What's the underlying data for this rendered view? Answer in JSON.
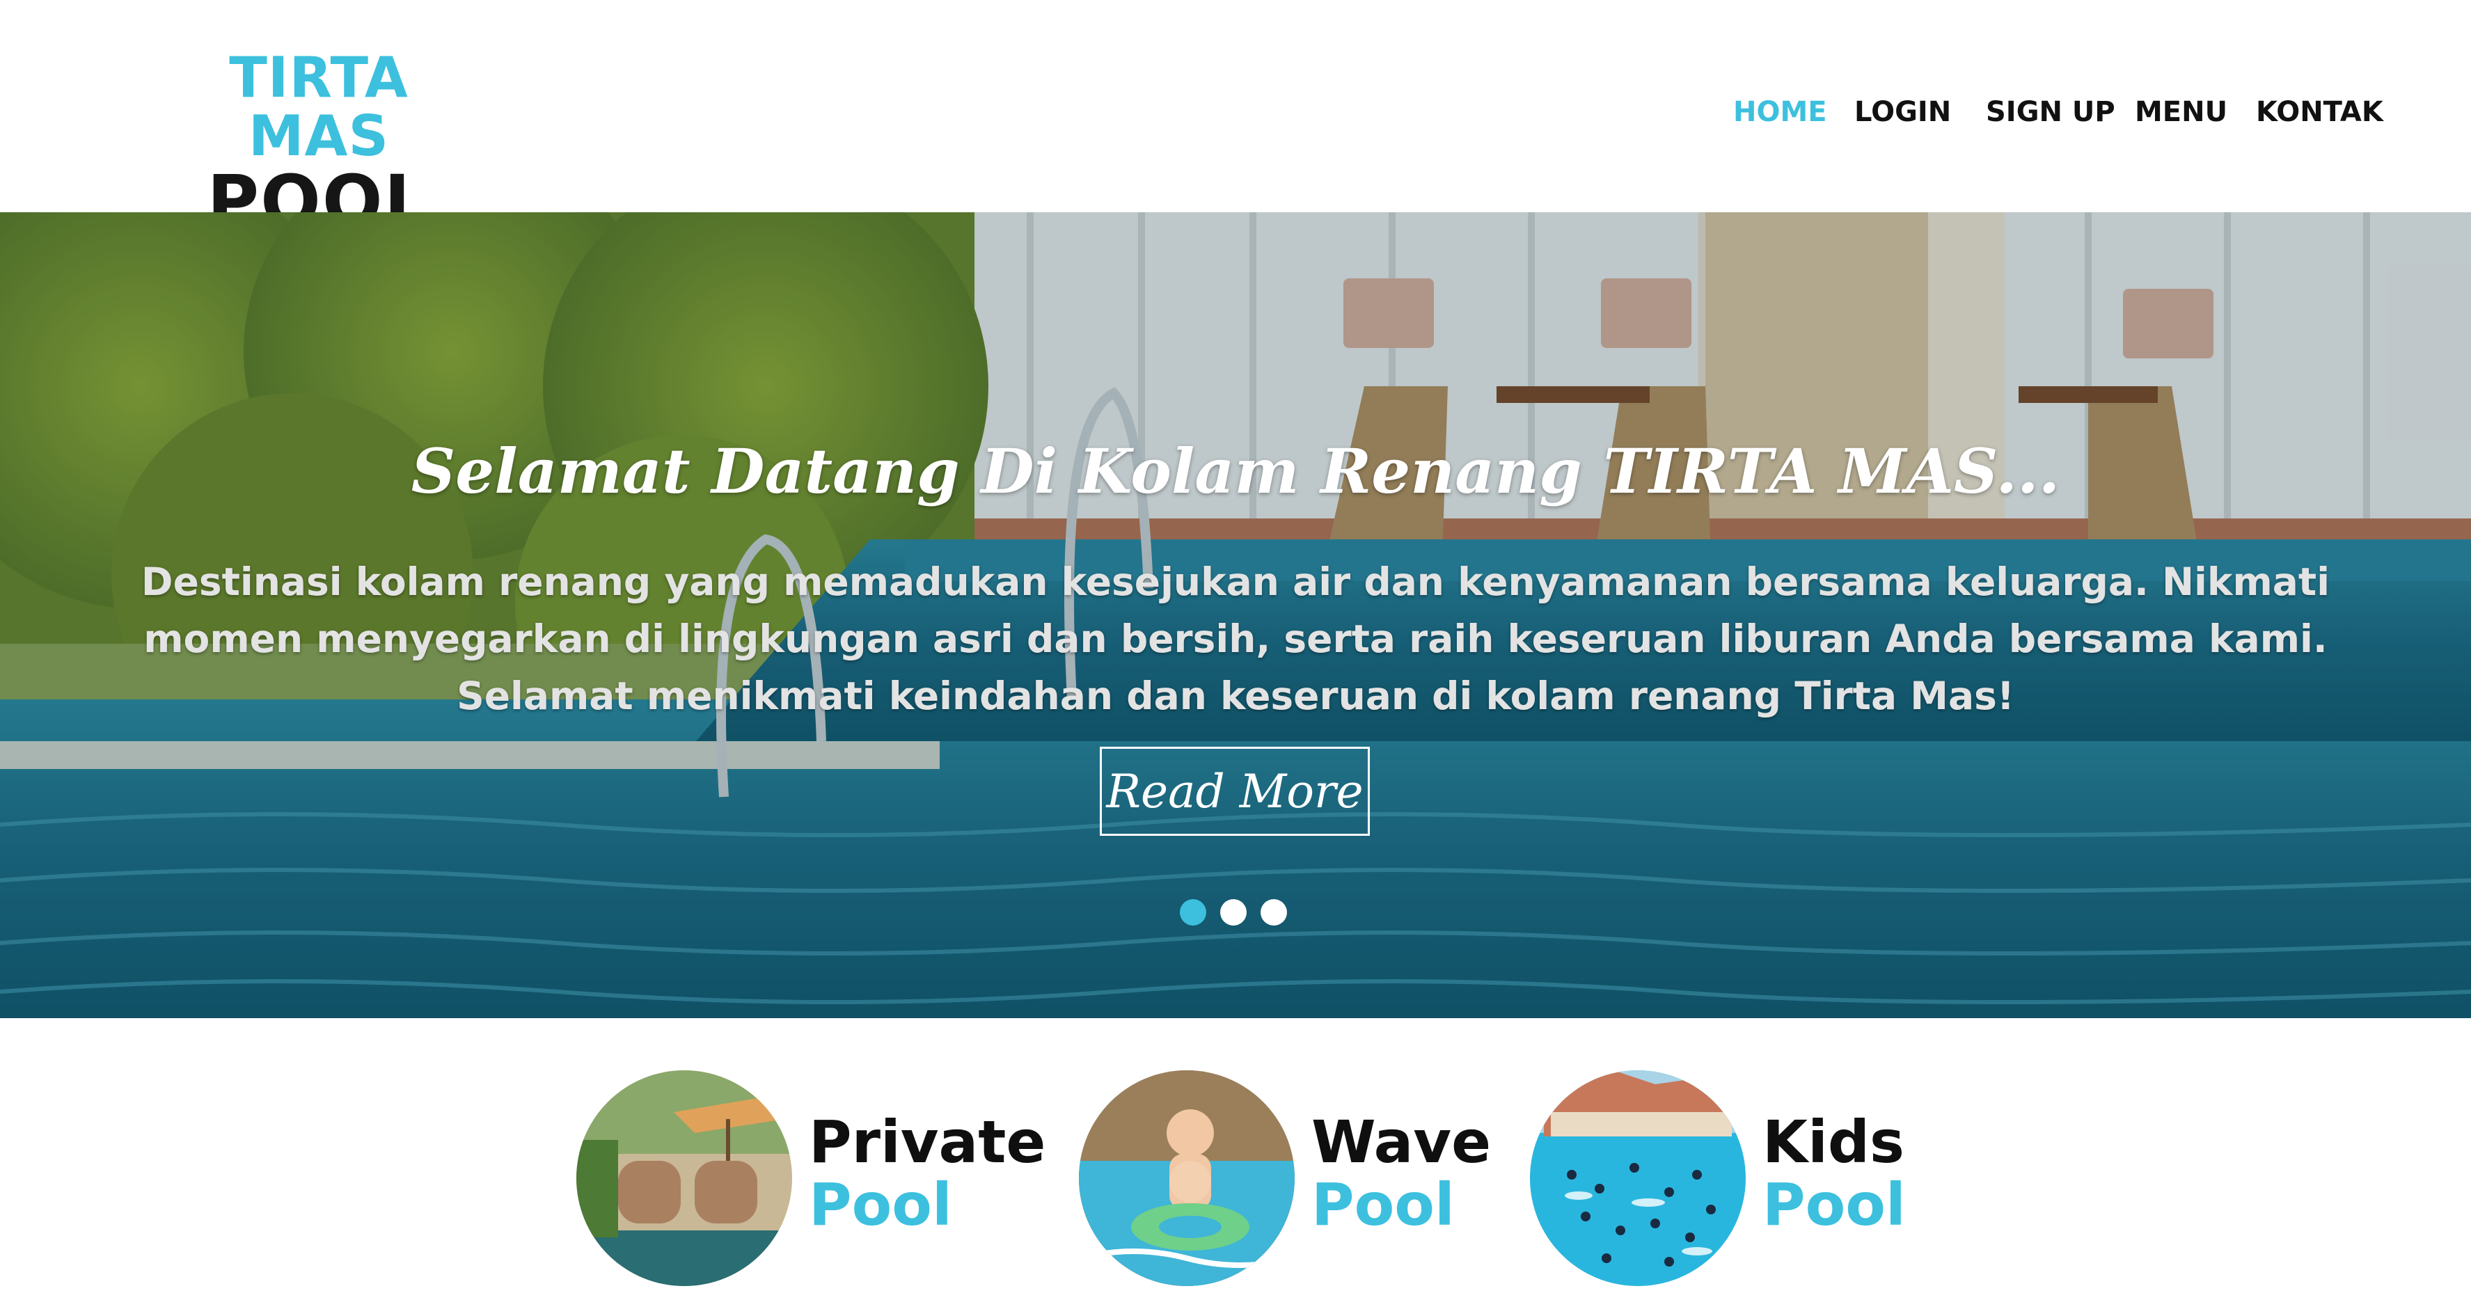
{
  "logo": {
    "line1": "TIRTA MAS",
    "line2": "POOL"
  },
  "nav": {
    "home": "HOME",
    "login": "LOGIN",
    "signup": "SIGN UP",
    "menu": "MENU",
    "kontak": "KONTAK",
    "active": "HOME"
  },
  "hero": {
    "title": "Selamat Datang Di Kolam Renang TIRTA MAS...",
    "description": "Destinasi kolam renang yang memadukan kesejukan air dan kenyamanan bersama keluarga. Nikmati momen menyegarkan di lingkungan asri dan bersih, serta raih keseruan liburan Anda bersama kami. Selamat menikmati keindahan dan keseruan di kolam renang Tirta Mas!",
    "button_label": "Read More",
    "slides_count": 3,
    "active_slide": 1
  },
  "features": [
    {
      "name": "Private",
      "sub": "Pool"
    },
    {
      "name": "Wave",
      "sub": "Pool"
    },
    {
      "name": "Kids",
      "sub": "Pool"
    }
  ],
  "colors": {
    "accent": "#3cc0de",
    "text_dark": "#111111",
    "pool_water": "#1c6f8a"
  }
}
